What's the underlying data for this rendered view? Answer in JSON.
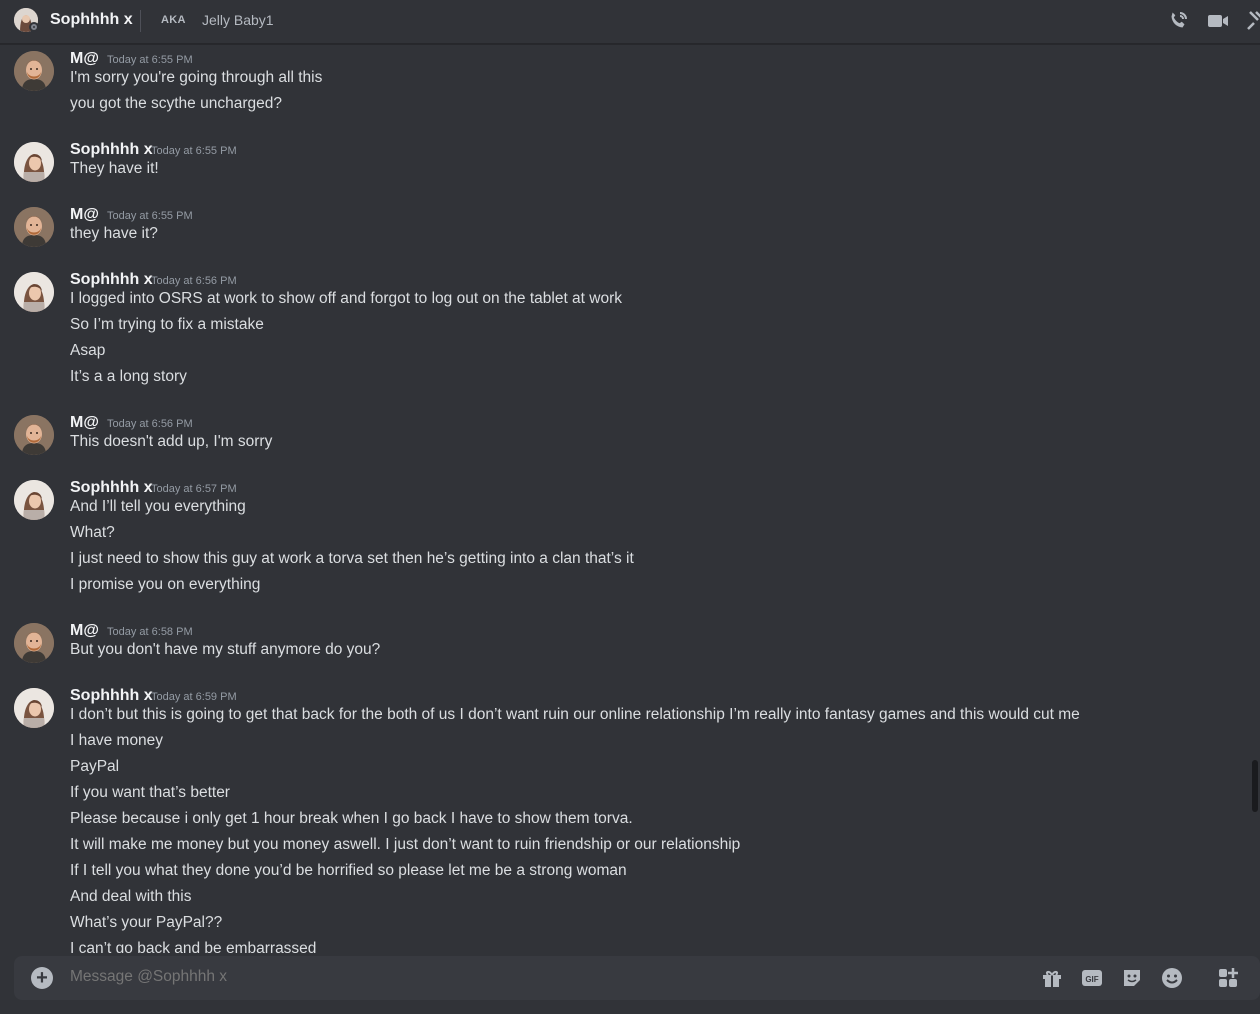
{
  "header": {
    "name": "Sophhhh x",
    "aka_label": "AKA",
    "alias": "Jelly Baby1"
  },
  "messages": [
    {
      "author": "M@",
      "avatar": "m",
      "time": "Today at 6:55 PM",
      "lines": [
        "I'm sorry you're going through all this",
        "you got the scythe uncharged?"
      ]
    },
    {
      "author": "Sophhhh x",
      "avatar": "s",
      "time": "Today at 6:55 PM",
      "lines": [
        "They have it!"
      ]
    },
    {
      "author": "M@",
      "avatar": "m",
      "time": "Today at 6:55 PM",
      "lines": [
        "they have it?"
      ]
    },
    {
      "author": "Sophhhh x",
      "avatar": "s",
      "time": "Today at 6:56 PM",
      "lines": [
        "I logged into OSRS at work to show off and forgot to log out on the tablet at work",
        "So I’m trying to fix a mistake",
        "Asap",
        "It’s a a long story"
      ]
    },
    {
      "author": "M@",
      "avatar": "m",
      "time": "Today at 6:56 PM",
      "lines": [
        "This doesn't add up, I'm sorry"
      ]
    },
    {
      "author": "Sophhhh x",
      "avatar": "s",
      "time": "Today at 6:57 PM",
      "lines": [
        "And I’ll tell you everything",
        "What?",
        "I just need to show this guy at work a torva set then he’s getting into a clan that’s it",
        "I promise you on everything"
      ]
    },
    {
      "author": "M@",
      "avatar": "m",
      "time": "Today at 6:58 PM",
      "lines": [
        "But you don't have my stuff anymore do you?"
      ]
    },
    {
      "author": "Sophhhh x",
      "avatar": "s",
      "time": "Today at 6:59 PM",
      "lines": [
        "I don’t but this is going to get that back for the both of us I don’t want ruin our online relationship I’m really into fantasy games and this would cut me",
        "I have money",
        "PayPal",
        "If you want that’s better",
        "Please because i only get 1 hour break when I go back I have to show them torva.",
        "It will make me money but you money aswell. I just don’t want to ruin friendship or our relationship",
        "If I tell you what they done you’d be horrified so please let me be a strong woman",
        "And deal with this",
        "What’s your PayPal??",
        "I can’t go back and be embarrassed"
      ]
    }
  ],
  "composer": {
    "placeholder": "Message @Sophhhh x",
    "gif_label": "GIF"
  },
  "colors": {
    "background": "#313338",
    "composer": "#383a40",
    "text": "#dbdee1",
    "muted": "#949ba4"
  }
}
